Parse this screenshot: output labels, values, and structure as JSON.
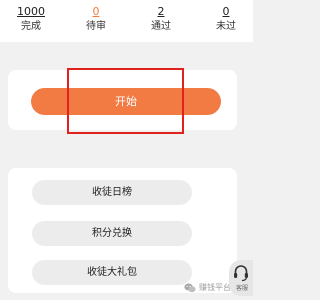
{
  "stats": [
    {
      "value": "1000",
      "label": "完成",
      "color": "#222222"
    },
    {
      "value": "0",
      "label": "待审",
      "color": "#f27b44"
    },
    {
      "value": "2",
      "label": "通过",
      "color": "#222222"
    },
    {
      "value": "0",
      "label": "未过",
      "color": "#222222"
    }
  ],
  "start_button": {
    "label": "开始",
    "color": "#f27b44"
  },
  "menu": [
    {
      "label": "收徒日榜"
    },
    {
      "label": "积分兑换"
    },
    {
      "label": "收徒大礼包"
    }
  ],
  "watermark": {
    "text": "赚钱平台副业",
    "icon": "wechat-icon"
  },
  "service": {
    "label": "客服",
    "icon": "headset-icon"
  },
  "annotation": {
    "color": "#e0211c"
  }
}
